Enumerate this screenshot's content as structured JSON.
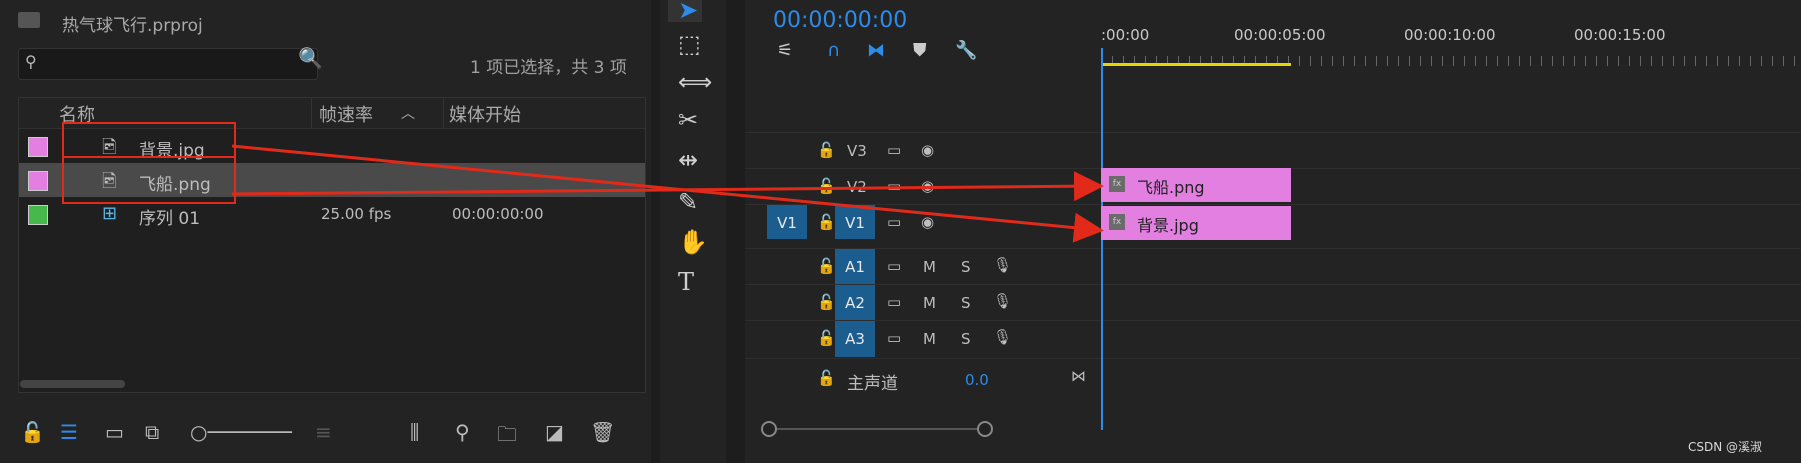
{
  "project": {
    "title": "热气球飞行.prproj",
    "selection_info": "1 项已选择，共 3 项",
    "columns": [
      "名称",
      "帧速率",
      "媒体开始"
    ],
    "items": [
      {
        "name": "背景.jpg",
        "fps": "",
        "start": "",
        "color": "#e27fe1"
      },
      {
        "name": "飞船.png",
        "fps": "",
        "start": "",
        "color": "#e27fe1"
      },
      {
        "name": "序列 01",
        "fps": "25.00 fps",
        "start": "00:00:00:00",
        "color": "#46b84c"
      }
    ]
  },
  "timeline": {
    "timecode": "00:00:00:00",
    "ruler": [
      ":00:00",
      "00:00:05:00",
      "00:00:10:00",
      "00:00:15:00"
    ],
    "video_tracks": [
      {
        "name": "V3"
      },
      {
        "name": "V2"
      },
      {
        "name": "V1"
      }
    ],
    "audio_tracks": [
      {
        "name": "A1",
        "m": "M",
        "s": "S"
      },
      {
        "name": "A2",
        "m": "M",
        "s": "S"
      },
      {
        "name": "A3",
        "m": "M",
        "s": "S"
      }
    ],
    "master": {
      "label": "主声道",
      "value": "0.0"
    },
    "clips": [
      {
        "name": "飞船.png",
        "track": "V2",
        "fx": "fx"
      },
      {
        "name": "背景.jpg",
        "track": "V1",
        "fx": "fx"
      }
    ],
    "source_patch": "V1"
  },
  "watermark": "CSDN @溪淑",
  "colors": {
    "accent": "#2d8ceb",
    "clip": "#e27fe1",
    "annotation": "#e12a1a"
  }
}
